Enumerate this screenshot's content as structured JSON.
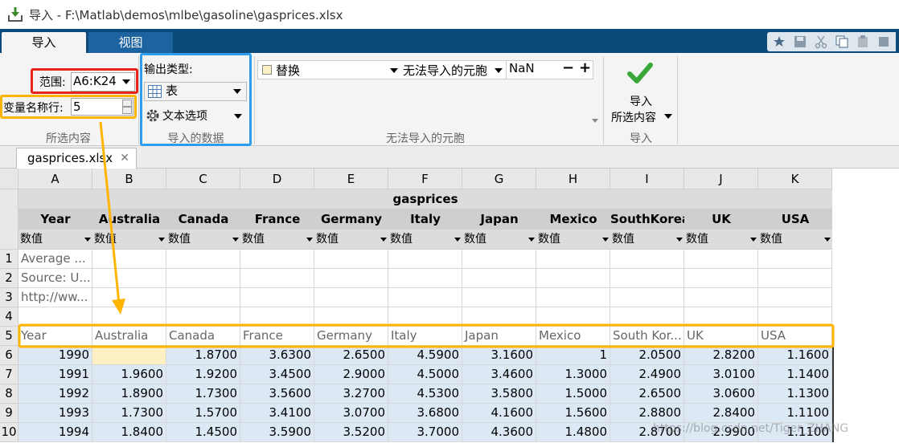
{
  "window": {
    "title": "导入 - F:\\Matlab\\demos\\mlbe\\gasoline\\gasprices.xlsx"
  },
  "ribbon_tabs": [
    "导入",
    "视图"
  ],
  "selection": {
    "range_label": "范围:",
    "range_value": "A6:K24",
    "varnames_row_label": "变量名称行:",
    "varnames_row_value": "5",
    "group_label": "所选内容"
  },
  "imported_data": {
    "output_type_label": "输出类型:",
    "output_type_value": "表",
    "text_options_label": "文本选项",
    "group_label": "导入的数据"
  },
  "unimportable": {
    "action_value": "替换",
    "rule_value": "无法导入的元胞",
    "replace_with": "NaN",
    "minus": "−",
    "plus": "+",
    "group_label": "无法导入的元胞"
  },
  "import_button": {
    "line1": "导入",
    "line2": "所选内容",
    "group_label": "导入"
  },
  "document_tab": {
    "name": "gasprices.xlsx",
    "close": "✕"
  },
  "grid": {
    "column_letters": [
      "A",
      "B",
      "C",
      "D",
      "E",
      "F",
      "G",
      "H",
      "I",
      "J",
      "K"
    ],
    "dataset_name": "gasprices",
    "variable_names": [
      "Year",
      "Australia",
      "Canada",
      "France",
      "Germany",
      "Italy",
      "Japan",
      "Mexico",
      "SouthKorea",
      "UK",
      "USA"
    ],
    "variable_type": "数值",
    "row_numbers": [
      "1",
      "2",
      "3",
      "4",
      "5",
      "6",
      "7",
      "8",
      "9",
      "10"
    ],
    "text_rows": [
      [
        "Average ...",
        "",
        "",
        "",
        "",
        "",
        "",
        "",
        "",
        "",
        ""
      ],
      [
        "Source: U...",
        "",
        "",
        "",
        "",
        "",
        "",
        "",
        "",
        "",
        ""
      ],
      [
        "http://ww...",
        "",
        "",
        "",
        "",
        "",
        "",
        "",
        "",
        "",
        ""
      ],
      [
        "",
        "",
        "",
        "",
        "",
        "",
        "",
        "",
        "",
        "",
        ""
      ],
      [
        "Year",
        "Australia",
        "Canada",
        "France",
        "Germany",
        "Italy",
        "Japan",
        "Mexico",
        "South Kor...",
        "UK",
        "USA"
      ]
    ],
    "data_rows": [
      [
        "1990",
        "",
        "1.8700",
        "3.6300",
        "2.6500",
        "4.5900",
        "3.1600",
        "1",
        "2.0500",
        "2.8200",
        "1.1600"
      ],
      [
        "1991",
        "1.9600",
        "1.9200",
        "3.4500",
        "2.9000",
        "4.5000",
        "3.4600",
        "1.3000",
        "2.4900",
        "3.0100",
        "1.1400"
      ],
      [
        "1992",
        "1.8900",
        "1.7300",
        "3.5600",
        "3.2700",
        "4.5300",
        "3.5800",
        "1.5000",
        "2.6500",
        "3.0600",
        "1.1300"
      ],
      [
        "1993",
        "1.7300",
        "1.5700",
        "3.4100",
        "3.0700",
        "3.6800",
        "4.1600",
        "1.5600",
        "2.8800",
        "2.8400",
        "1.1100"
      ],
      [
        "1994",
        "1.8400",
        "1.4500",
        "3.5900",
        "3.5200",
        "3.7000",
        "4.3600",
        "1.4800",
        "2.8700",
        "2.9900",
        "1.1100"
      ]
    ]
  },
  "colors": {
    "tabbar": "#0c4a7a",
    "highlight_red": "#e8231a",
    "highlight_orange": "#ffb400",
    "highlight_blue": "#2e9cf0",
    "selected_cells": "#dce9f5",
    "unimportable_cell": "#fdf0c4"
  },
  "watermark": "https://blog.csdn.net/Tiger_ZHANG"
}
